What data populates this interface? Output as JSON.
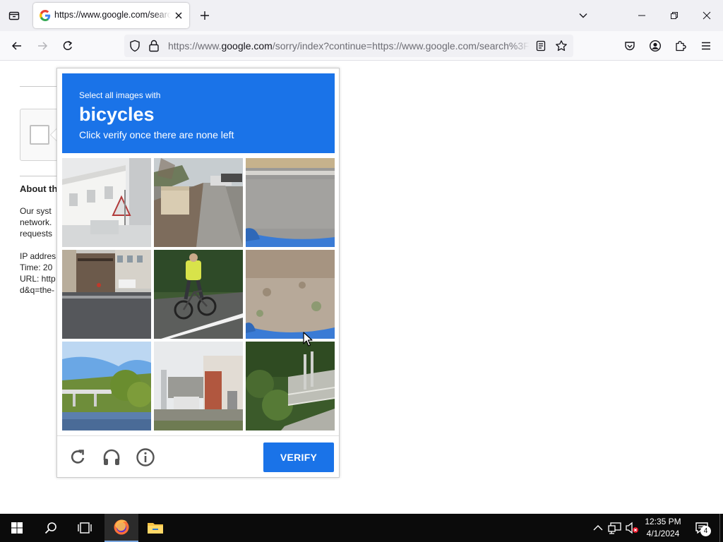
{
  "browser": {
    "tab": {
      "title": "https://www.google.com/search?q=the",
      "favicon": "google-g-icon"
    },
    "url": {
      "prefix": "https://www.",
      "host": "google.com",
      "rest": "/sorry/index?continue=https://www.google.com/search%3F"
    },
    "icons": {
      "tab_list": "tab-list-icon",
      "new_tab": "plus-icon",
      "tabs_overflow": "chevron-down-icon",
      "back": "back-arrow-icon",
      "forward": "forward-arrow-icon",
      "reload": "reload-icon",
      "tracking": "shield-icon",
      "lock": "lock-icon",
      "reader": "reader-view-icon",
      "bookmark": "star-icon",
      "pocket": "pocket-icon",
      "account": "account-icon",
      "extensions": "puzzle-icon",
      "menu": "hamburger-menu-icon"
    }
  },
  "page": {
    "heading": "About th",
    "para_lines": [
      "Our syst",
      "network.",
      "requests"
    ],
    "info_lines": [
      "IP addres",
      "Time: 20",
      "URL: http",
      "d&q=the-"
    ]
  },
  "captcha": {
    "instruction_line1": "Select all images with",
    "keyword": "bicycles",
    "instruction_line2": "Click verify once there are none left",
    "verify_label": "VERIFY",
    "header_color": "#1a73e8",
    "tiles": [
      {
        "subject": "white building with street sign"
      },
      {
        "subject": "sidewalk with parked cars"
      },
      {
        "subject": "asphalt road close-up with blue object"
      },
      {
        "subject": "city intersection with buildings"
      },
      {
        "subject": "cyclist on road"
      },
      {
        "subject": "sandy ground with blue object"
      },
      {
        "subject": "river bridge with trees"
      },
      {
        "subject": "house and parked van"
      },
      {
        "subject": "fence by overgrown canal"
      }
    ],
    "icons": {
      "reload": "reload-icon",
      "audio": "headphones-icon",
      "info": "info-icon"
    }
  },
  "taskbar": {
    "time": "12:35 PM",
    "date": "4/1/2024",
    "notification_count": "4",
    "icons": [
      "windows-start-icon",
      "search-icon",
      "task-view-icon",
      "firefox-icon",
      "file-explorer-icon"
    ]
  }
}
